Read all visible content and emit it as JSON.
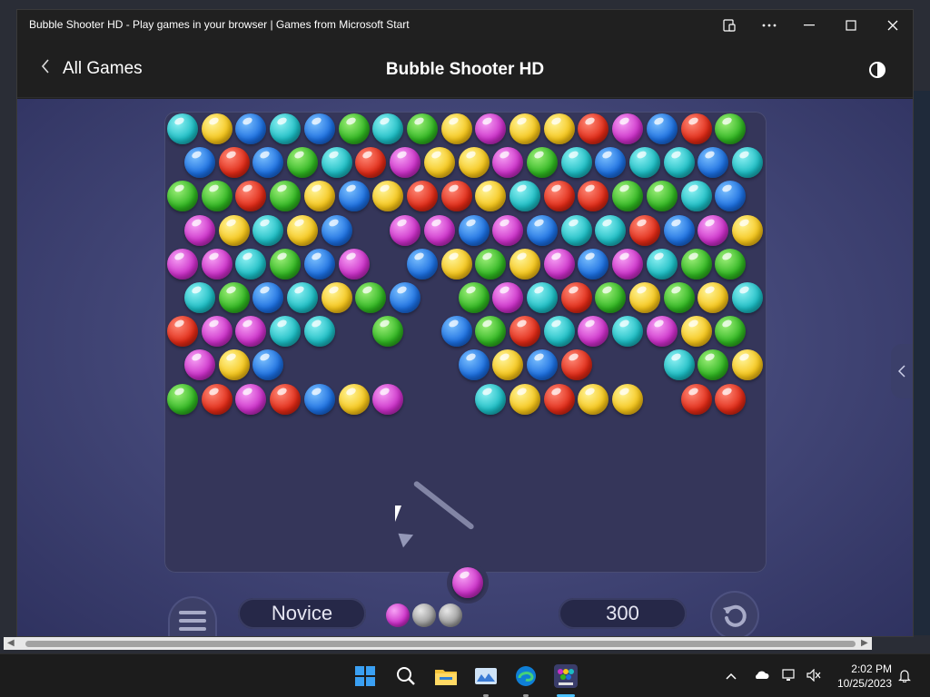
{
  "window": {
    "title": "Bubble Shooter HD - Play games in your browser | Games from Microsoft Start",
    "controls": [
      "cast-icon",
      "more-icon",
      "minimize-icon",
      "maximize-icon",
      "close-icon"
    ]
  },
  "header": {
    "back_label": "All Games",
    "title": "Bubble Shooter HD",
    "theme_icon": "contrast-icon"
  },
  "game": {
    "colors": {
      "c": "#1bbcc3",
      "y": "#f5c519",
      "b": "#1c6fe0",
      "g": "#2fb521",
      "m": "#cb2fc8",
      "r": "#e02a16"
    },
    "rows": [
      "cybcbgcgymyyrmbrg",
      "brbgcrmyymgcbccbc",
      "ggrgybyrrycrrggcb",
      "mycyb.mmbmbccrbmy",
      "mmcgbm.bygymbmcgg",
      "cgbcygb.gmcrgygyc",
      "rmmcc.g.bgrcmcmyg",
      "myb.....bybr..cgy",
      "grmrbym..cyryy.rr"
    ],
    "current_bubble": "m",
    "next_bubbles": [
      "m",
      "gray",
      "gray"
    ],
    "level": "Novice",
    "score": "300"
  },
  "taskbar": {
    "icons": [
      "windows-start-icon",
      "search-icon",
      "file-explorer-icon",
      "photos-icon",
      "edge-browser-icon",
      "bubble-shooter-app-icon"
    ],
    "time": "2:02 PM",
    "date": "10/25/2023"
  }
}
